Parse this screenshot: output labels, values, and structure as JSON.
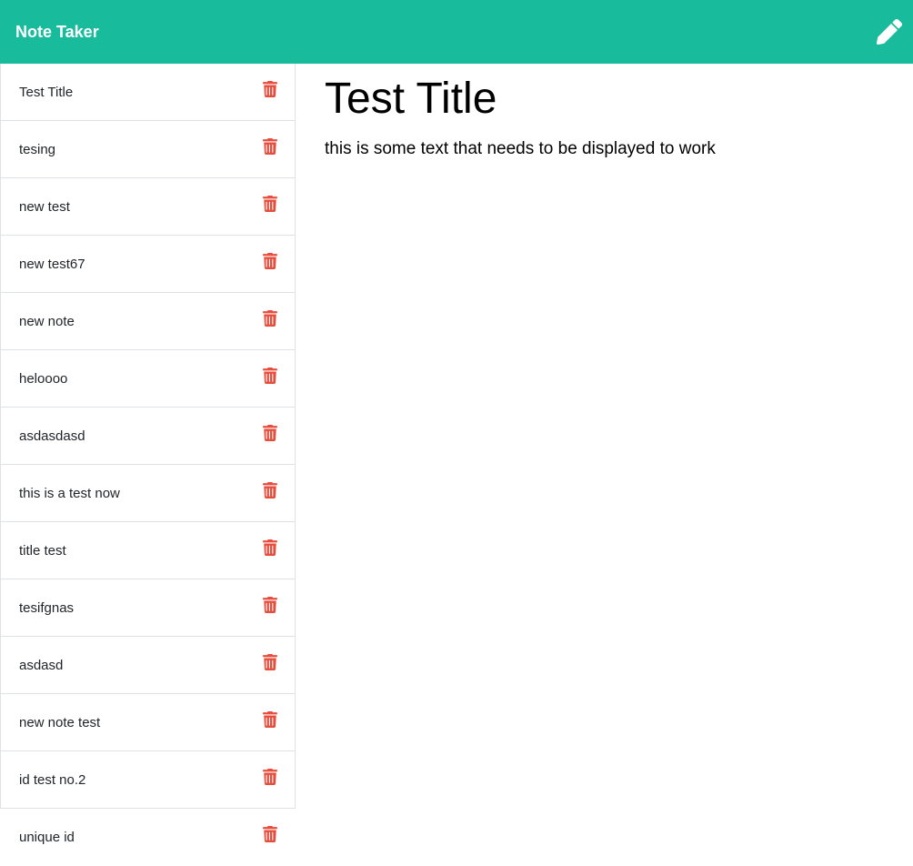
{
  "app": {
    "title": "Note Taker",
    "new_note_icon": "pencil-icon"
  },
  "colors": {
    "navbar": "#18bc9c",
    "delete": "#e74c3c"
  },
  "notes": [
    {
      "title": "Test Title",
      "icon": "trash-icon"
    },
    {
      "title": "tesing",
      "icon": "trash-icon"
    },
    {
      "title": "new test",
      "icon": "trash-icon"
    },
    {
      "title": "new test67",
      "icon": "trash-icon"
    },
    {
      "title": "new note",
      "icon": "trash-icon"
    },
    {
      "title": "heloooo",
      "icon": "trash-icon"
    },
    {
      "title": "asdasdasd",
      "icon": "trash-icon"
    },
    {
      "title": "this is a test now",
      "icon": "trash-icon"
    },
    {
      "title": "title test",
      "icon": "trash-icon"
    },
    {
      "title": "tesifgnas",
      "icon": "trash-icon"
    },
    {
      "title": "asdasd",
      "icon": "trash-icon"
    },
    {
      "title": "new note test",
      "icon": "trash-icon"
    },
    {
      "title": "id test no.2",
      "icon": "trash-icon"
    },
    {
      "title": "unique id",
      "icon": "trash-icon"
    }
  ],
  "active_note": {
    "title": "Test Title",
    "text": "this is some text that needs to be displayed to work"
  }
}
